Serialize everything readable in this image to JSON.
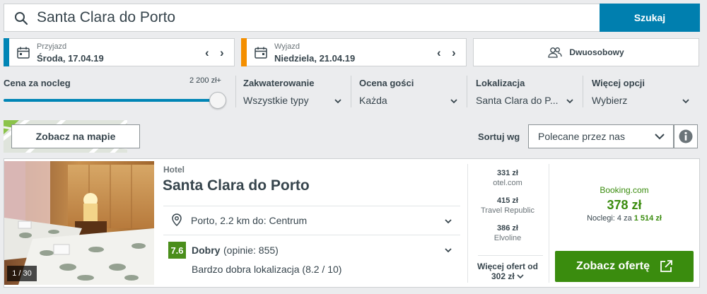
{
  "search": {
    "query": "Santa Clara do Porto",
    "button_label": "Szukaj"
  },
  "checkin": {
    "label": "Przyjazd",
    "value": "Środa, 17.04.19",
    "accent": "#0085b5"
  },
  "checkout": {
    "label": "Wyjazd",
    "value": "Niedziela, 21.04.19",
    "accent": "#f48f00"
  },
  "room": {
    "label": "Dwuosobowy"
  },
  "filters": {
    "price": {
      "title": "Cena za nocleg",
      "max_label": "2 200 zł+",
      "level": 1.0
    },
    "accommodation": {
      "title": "Zakwaterowanie",
      "value": "Wszystkie typy"
    },
    "rating": {
      "title": "Ocena gości",
      "value": "Każda"
    },
    "location": {
      "title": "Lokalizacja",
      "value": "Santa Clara do P..."
    },
    "more": {
      "title": "Więcej opcji",
      "value": "Wybierz"
    }
  },
  "map": {
    "button_label": "Zobacz na mapie"
  },
  "sort": {
    "label": "Sortuj wg",
    "value": "Polecane przez nas"
  },
  "hotel": {
    "type": "Hotel",
    "name": "Santa Clara do Porto",
    "photo_counter": "1 / 30",
    "location": "Porto, 2.2 km do: Centrum",
    "rating_score": "7.6",
    "rating_text": "Dobry",
    "rating_count": "(opinie: 855)",
    "highlight": "Bardzo dobra lokalizacja (8.2 / 10)",
    "prices": [
      {
        "price": "331 zł",
        "site": "otel.com"
      },
      {
        "price": "415 zł",
        "site": "Travel Republic"
      },
      {
        "price": "386 zł",
        "site": "Elvoline"
      }
    ],
    "more_offers_label": "Więcej ofert od",
    "more_offers_price": "302 zł",
    "best": {
      "site": "Booking.com",
      "price": "378 zł",
      "nights_label": "Noclegi: 4 za",
      "total": "1 514 zł"
    },
    "offer_button": "Zobacz ofertę"
  },
  "colors": {
    "brand_blue": "#007faf",
    "deal_green": "#3a8c0e",
    "rating_green": "#4a8e1b"
  }
}
